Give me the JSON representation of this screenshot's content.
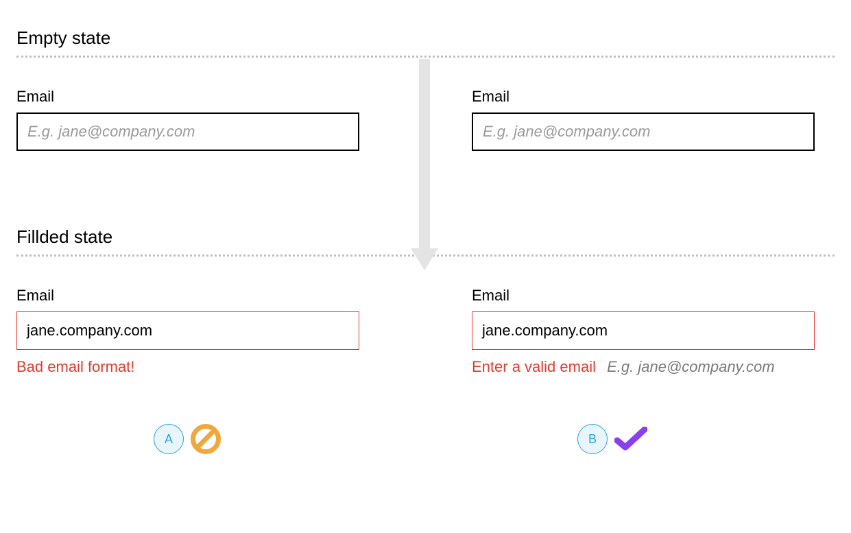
{
  "sections": {
    "empty_title": "Empty state",
    "filled_title": "Fillded state"
  },
  "field_label": "Email",
  "placeholder": "E.g. jane@company.com",
  "filled_value": "jane.company.com",
  "errors": {
    "a": "Bad email format!",
    "b": "Enter a valid email",
    "b_hint": "E.g. jane@company.com"
  },
  "badges": {
    "a": "A",
    "b": "B"
  }
}
